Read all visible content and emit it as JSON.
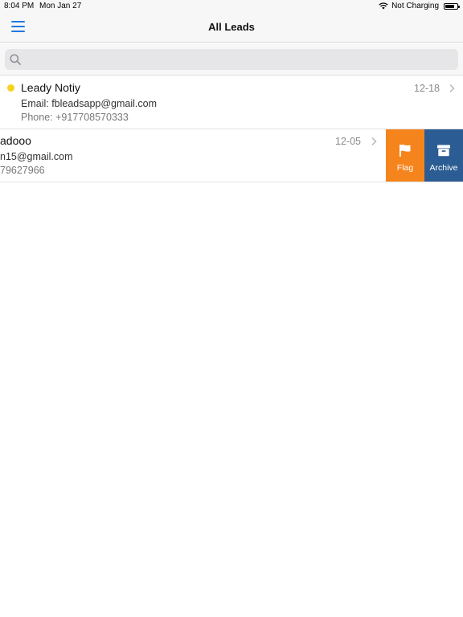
{
  "status_bar": {
    "time": "8:04 PM",
    "date": "Mon Jan 27",
    "charging": "Not Charging",
    "battery_level": 0.75
  },
  "nav": {
    "title": "All Leads",
    "menu_icon": "hamburger-icon",
    "accent_color": "#1e7ae0"
  },
  "search": {
    "placeholder": "",
    "value": ""
  },
  "leads": [
    {
      "name": "Leady Notiy",
      "email": "Email: fbleadsapp@gmail.com",
      "phone": "Phone: +917708570333",
      "date": "12-18",
      "status_color": "#f4d21f"
    },
    {
      "name": "adooo",
      "email": "n15@gmail.com",
      "phone": "79627966",
      "date": "12-05"
    }
  ],
  "swipe_actions": {
    "flag_label": "Flag",
    "flag_color": "#f5841c",
    "flag_icon": "flag-icon",
    "archive_label": "Archive",
    "archive_color": "#2b5c93",
    "archive_icon": "archive-icon"
  }
}
